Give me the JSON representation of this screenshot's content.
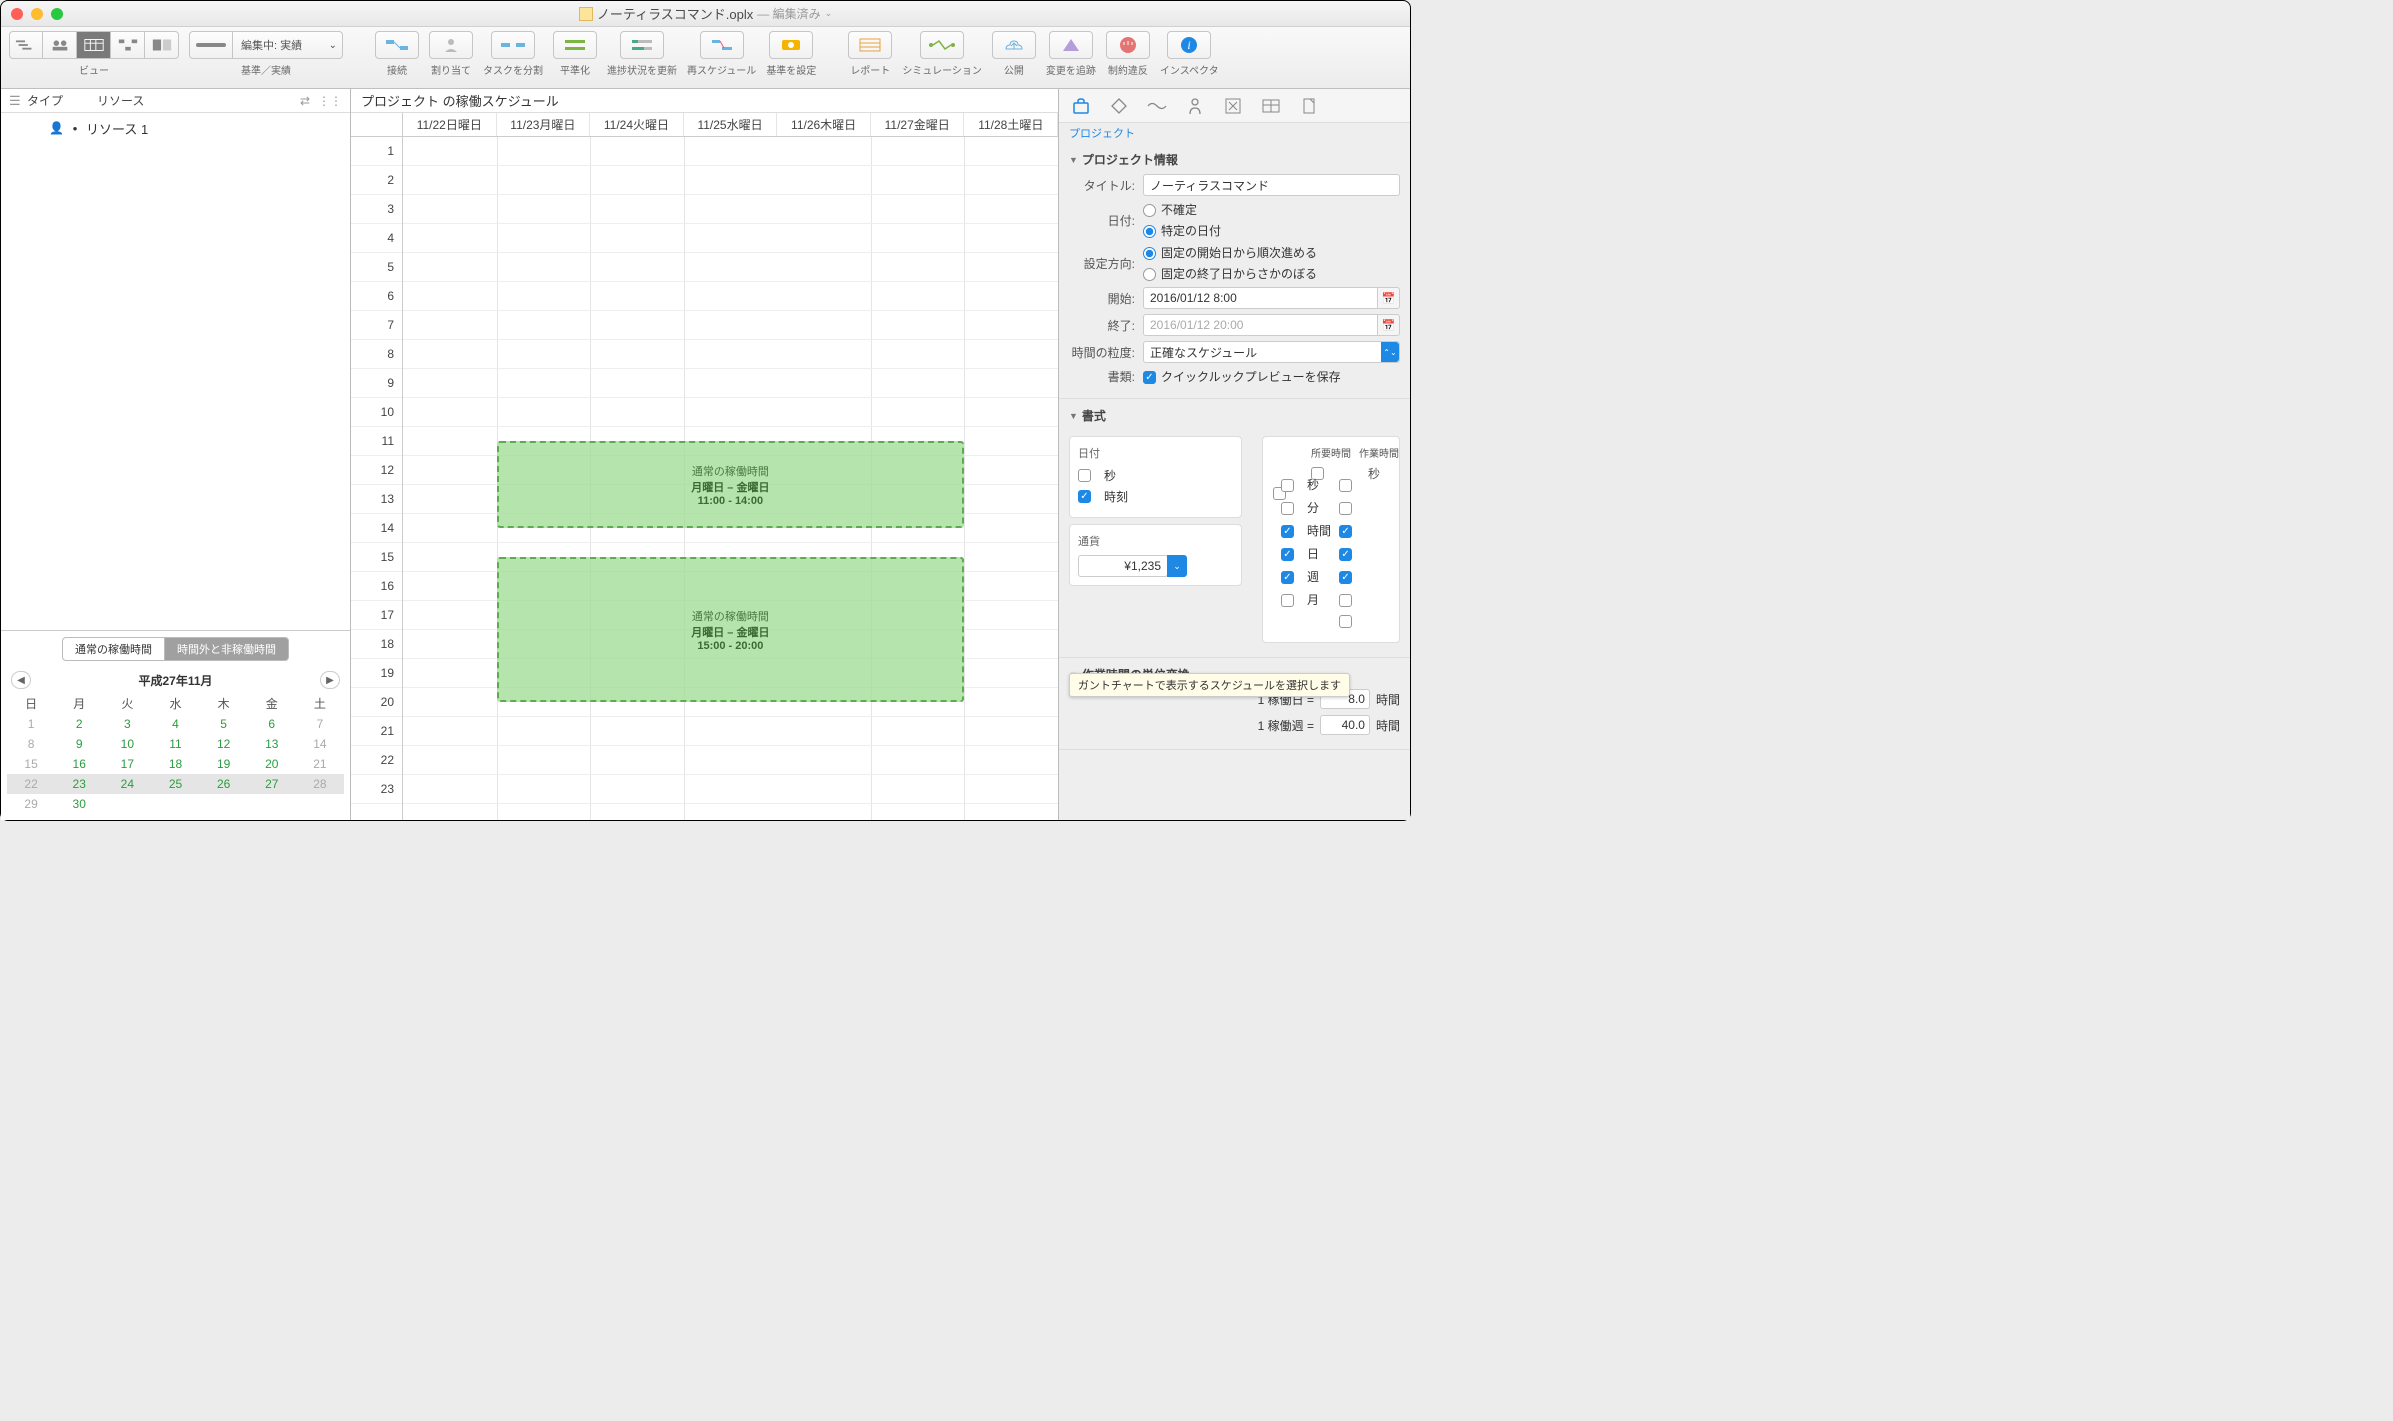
{
  "window": {
    "filename": "ノーティラスコマンド.oplx",
    "status": "— 編集済み"
  },
  "toolbar": {
    "view_label": "ビュー",
    "baseline_label": "基準／実績",
    "baseline_select": "編集中: 実績",
    "connect": "接続",
    "assign": "割り当て",
    "split": "タスクを分割",
    "level": "平準化",
    "catchup": "進捗状況を更新",
    "reschedule": "再スケジュール",
    "set_baseline": "基準を設定",
    "reports": "レポート",
    "simulation": "シミュレーション",
    "publish": "公開",
    "track_changes": "変更を追跡",
    "violations": "制約違反",
    "inspector": "インスペクタ"
  },
  "left": {
    "col_type": "タイプ",
    "col_resource": "リソース",
    "resource1": "リソース 1",
    "tab_normal": "通常の稼働時間",
    "tab_extra": "時間外と非稼働時間",
    "cal_title": "平成27年11月",
    "dow": [
      "日",
      "月",
      "火",
      "水",
      "木",
      "金",
      "土"
    ],
    "days": [
      [
        1,
        2,
        3,
        4,
        5,
        6,
        7
      ],
      [
        8,
        9,
        10,
        11,
        12,
        13,
        14
      ],
      [
        15,
        16,
        17,
        18,
        19,
        20,
        21
      ],
      [
        22,
        23,
        24,
        25,
        26,
        27,
        28
      ],
      [
        29,
        30,
        "",
        "",
        "",
        "",
        ""
      ]
    ]
  },
  "schedule": {
    "title": "プロジェクト の稼働スケジュール",
    "days": [
      "11/22日曜日",
      "11/23月曜日",
      "11/24火曜日",
      "11/25水曜日",
      "11/26木曜日",
      "11/27金曜日",
      "11/28土曜日"
    ],
    "hours": [
      "1",
      "2",
      "3",
      "4",
      "5",
      "6",
      "7",
      "8",
      "9",
      "10",
      "11",
      "12",
      "13",
      "14",
      "15",
      "16",
      "17",
      "18",
      "19",
      "20",
      "21",
      "22",
      "23"
    ],
    "block1": {
      "title": "通常の稼働時間",
      "days": "月曜日 – 金曜日",
      "time": "11:00 - 14:00"
    },
    "block2": {
      "title": "通常の稼働時間",
      "days": "月曜日 – 金曜日",
      "time": "15:00 - 20:00"
    }
  },
  "inspector": {
    "tab_label": "プロジェクト",
    "project_info": "プロジェクト情報",
    "title_label": "タイトル:",
    "title_value": "ノーティラスコマンド",
    "date_label": "日付:",
    "date_undetermined": "不確定",
    "date_specific": "特定の日付",
    "direction_label": "設定方向:",
    "direction_forward": "固定の開始日から順次進める",
    "direction_backward": "固定の終了日からさかのぼる",
    "start_label": "開始:",
    "start_value": "2016/01/12 8:00",
    "end_label": "終了:",
    "end_value": "2016/01/12 20:00",
    "granularity_label": "時間の粒度:",
    "granularity_value": "正確なスケジュール",
    "doc_label": "書類:",
    "quicklook": "クイックルックプレビューを保存",
    "format": "書式",
    "fmt_date": "日付",
    "fmt_seconds": "秒",
    "fmt_time": "時刻",
    "fmt_currency": "通貨",
    "currency_value": "¥1,235",
    "fmt_duration": "所要時間",
    "fmt_effort": "作業時間",
    "unit_sec": "秒",
    "unit_min": "分",
    "unit_hour": "時間",
    "unit_day": "日",
    "unit_week": "週",
    "unit_month": "月",
    "tooltip": "ガントチャートで表示するスケジュールを選択します",
    "conversion": "作業時間の単位変換",
    "conv_day_label": "1 稼働日 =",
    "conv_day_value": "8.0",
    "conv_day_unit": "時間",
    "conv_week_label": "1 稼働週 =",
    "conv_week_value": "40.0",
    "conv_week_unit": "時間"
  }
}
